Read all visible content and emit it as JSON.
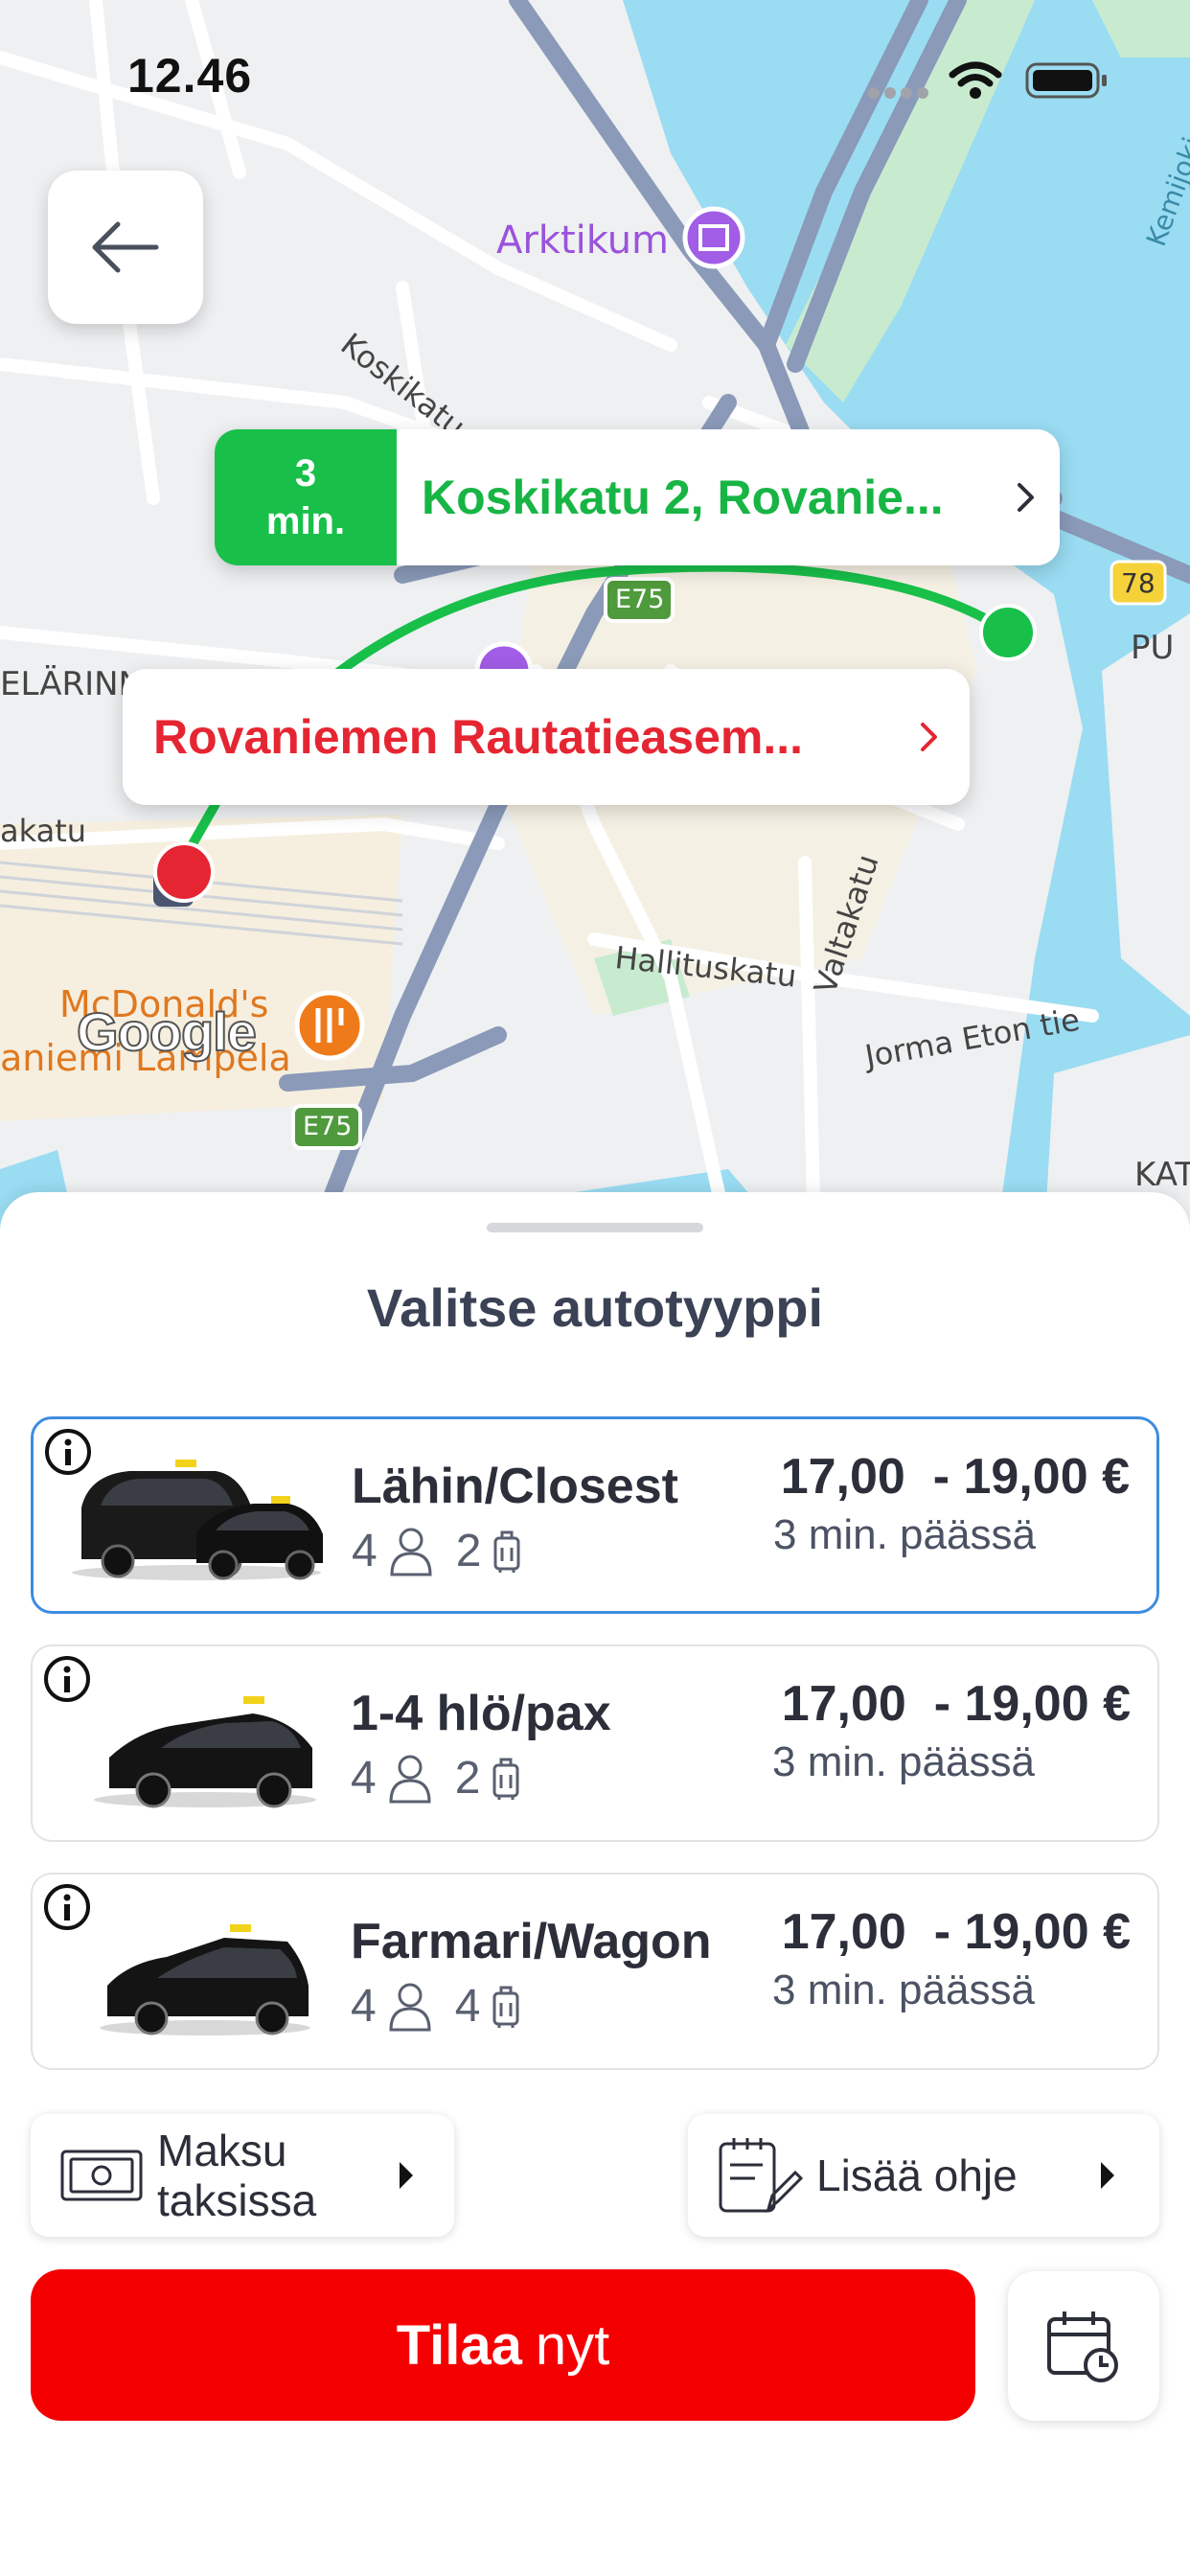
{
  "status_bar": {
    "time": "12.46"
  },
  "map": {
    "pickup": {
      "eta_value": "3",
      "eta_unit": "min.",
      "address": "Koskikatu 2, Rovanie..."
    },
    "destination": {
      "address": "Rovaniemen Rautatieasem..."
    },
    "labels": {
      "arktikum": "Arktikum",
      "koskikatu": "Koskikatu",
      "hallituskatu": "Hallituskatu",
      "valtakatu": "Valtakatu",
      "jorma_eton_tie": "Jorma Eton tie",
      "mcdonalds_1": "McDonald's",
      "mcdonalds_2": "aniemi Lampela",
      "elarinne": "ELÄRINN",
      "katu": "akatu",
      "e75_a": "E75",
      "e75_b": "E75",
      "road_78": "78",
      "pu": "PU",
      "kat": "KAT",
      "kemijoki": "Kemijoki",
      "google": "Google"
    },
    "colors": {
      "route": "#18c04a",
      "pickup_pin": "#18c04a",
      "destination_pin": "#e52632",
      "water": "#9adcf2"
    }
  },
  "sheet": {
    "title": "Valitse autotyyppi",
    "car_types": [
      {
        "name": "Lähin/Closest",
        "passengers": "4",
        "luggage": "2",
        "price_low": "17,00",
        "price_high": "- 19,00 €",
        "eta": "3 min. päässä",
        "selected": true
      },
      {
        "name": "1-4 hlö/pax",
        "passengers": "4",
        "luggage": "2",
        "price_low": "17,00",
        "price_high": "- 19,00 €",
        "eta": "3 min. päässä",
        "selected": false
      },
      {
        "name": "Farmari/Wagon",
        "passengers": "4",
        "luggage": "4",
        "price_low": "17,00",
        "price_high": "- 19,00 €",
        "eta": "3 min. päässä",
        "selected": false
      }
    ],
    "payment": {
      "line1": "Maksu",
      "line2": "taksissa"
    },
    "note": {
      "label": "Lisää ohje"
    },
    "order": {
      "bold": "Tilaa",
      "rest": "nyt"
    }
  },
  "icons": [
    "back-arrow-icon",
    "info-icon",
    "person-icon",
    "luggage-icon",
    "cash-icon",
    "note-icon",
    "calendar-clock-icon",
    "chevron-right-icon",
    "caret-right-icon"
  ]
}
